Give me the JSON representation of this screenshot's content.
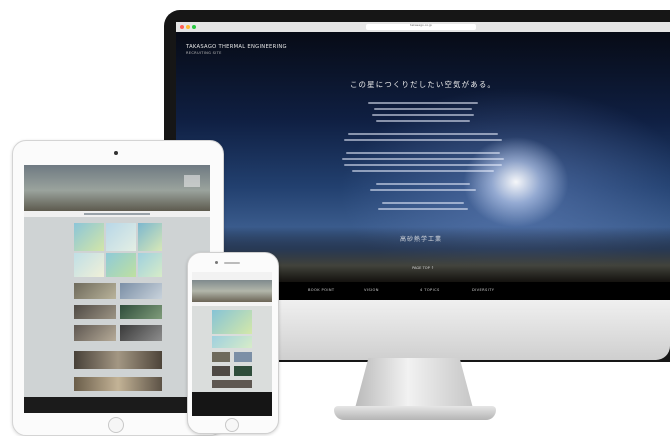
{
  "desktop": {
    "url": "takasago.co.jp",
    "brand": "TAKASAGO THERMAL ENGINEERING",
    "brand_sub": "RECRUITING SITE",
    "heading": "この星につくりだしたい空気がある。",
    "signature": "高砂熱学工業",
    "page_top": "PAGE TOP ↑",
    "nav": [
      "BOOK POINT",
      "VISION",
      "4 TOPICS",
      "DIVERSITY"
    ]
  },
  "colors": {
    "sky_top": "#070b16",
    "sky_mid": "#22406f",
    "footer": "#000000",
    "device_white": "#fbfbfb"
  },
  "icons": [
    "close-dot-icon",
    "minimize-dot-icon",
    "zoom-dot-icon",
    "home-button-icon"
  ]
}
